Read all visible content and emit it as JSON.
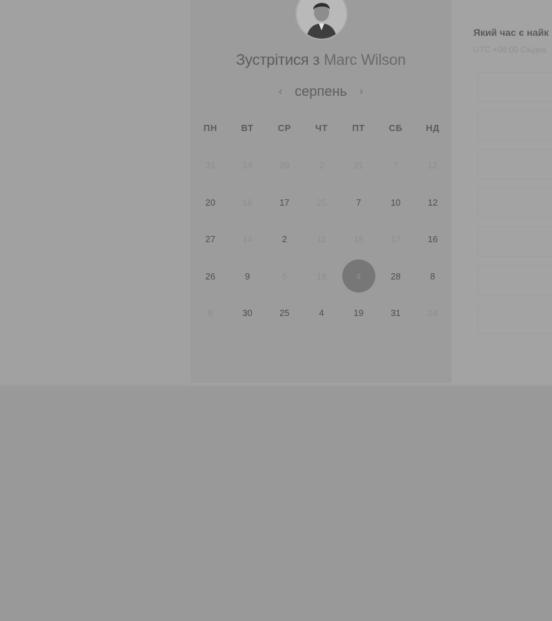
{
  "booking": {
    "title_prefix": "Зустрітися з",
    "host_name": "Marc Wilson"
  },
  "calendar": {
    "month": "серпень",
    "prev_icon": "chevron-left-icon",
    "next_icon": "chevron-right-icon",
    "weekdays": [
      "ПН",
      "ВТ",
      "СР",
      "ЧТ",
      "ПТ",
      "СБ",
      "НД"
    ],
    "days": [
      {
        "label": "31",
        "available": false
      },
      {
        "label": "14",
        "available": false
      },
      {
        "label": "29",
        "available": false
      },
      {
        "label": "2",
        "available": false
      },
      {
        "label": "21",
        "available": false
      },
      {
        "label": "7",
        "available": false
      },
      {
        "label": "12",
        "available": false
      },
      {
        "label": "20",
        "available": true
      },
      {
        "label": "18",
        "available": false
      },
      {
        "label": "17",
        "available": true
      },
      {
        "label": "25",
        "available": false
      },
      {
        "label": "7",
        "available": true
      },
      {
        "label": "10",
        "available": true
      },
      {
        "label": "12",
        "available": true
      },
      {
        "label": "27",
        "available": true
      },
      {
        "label": "14",
        "available": false
      },
      {
        "label": "2",
        "available": true
      },
      {
        "label": "11",
        "available": false
      },
      {
        "label": "18",
        "available": false
      },
      {
        "label": "17",
        "available": false
      },
      {
        "label": "16",
        "available": true
      },
      {
        "label": "26",
        "available": true
      },
      {
        "label": "9",
        "available": true
      },
      {
        "label": "5",
        "available": false
      },
      {
        "label": "18",
        "available": false
      },
      {
        "label": "4",
        "available": true,
        "selected": true
      },
      {
        "label": "28",
        "available": true
      },
      {
        "label": "8",
        "available": true
      },
      {
        "label": "8",
        "available": false
      },
      {
        "label": "30",
        "available": true
      },
      {
        "label": "25",
        "available": true
      },
      {
        "label": "4",
        "available": true
      },
      {
        "label": "19",
        "available": true
      },
      {
        "label": "31",
        "available": true
      },
      {
        "label": "24",
        "available": false
      }
    ]
  },
  "time_panel": {
    "heading": "Який час є найк",
    "timezone": "UTC +08:00 Східна"
  },
  "colors": {
    "overlay": "#999999",
    "selected_day": "#6b6b6b"
  }
}
